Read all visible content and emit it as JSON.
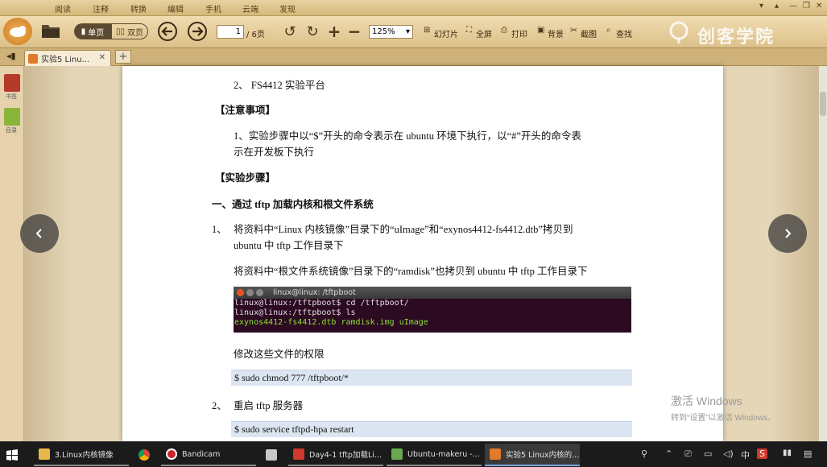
{
  "menubar": {
    "items": [
      "阅读",
      "注释",
      "转换",
      "编辑",
      "手机",
      "云端",
      "发现"
    ]
  },
  "toolbar": {
    "single_page": "单页",
    "double_page": "双页",
    "page_input": "1",
    "page_total": "/ 6页",
    "zoom": "125%",
    "slideshow": "幻灯片",
    "fullscreen": "全屏",
    "print": "打印",
    "background": "背景",
    "screenshot": "截图",
    "search": "查找",
    "brand": "创客学院"
  },
  "tabs": [
    {
      "label": "实验5 Linu..."
    }
  ],
  "sidebar": {
    "bookmark": "书签",
    "toc": "目录"
  },
  "document": {
    "l1": "2、 FS4412 实验平台",
    "l2": "【注意事项】",
    "l3": "1、实验步骤中以“$”开头的命令表示在 ubuntu 环境下执行，以“#”开头的命令表",
    "l4": "示在开发板下执行",
    "l5": "【实验步骤】",
    "l6": "一、通过 tftp 加载内核和根文件系统",
    "l7_num": "1、",
    "l7": "将资料中“Linux 内核镜像”目录下的“uImage”和“exynos4412-fs4412.dtb”拷贝到",
    "l8": "ubuntu 中 tftp 工作目录下",
    "l9": "将资料中“根文件系统镜像”目录下的“ramdisk”也拷贝到 ubuntu 中 tftp 工作目录下",
    "terminal": {
      "title": "linux@linux: /tftpboot",
      "line1": "linux@linux:/tftpboot$ cd /tftpboot/",
      "line2": "linux@linux:/tftpboot$ ls",
      "line3": "exynos4412-fs4412.dtb  ramdisk.img  uImage"
    },
    "l10": "修改这些文件的权限",
    "code1": "$ sudo    chmod    777    /tftpboot/*",
    "l11_num": "2、",
    "l11": "重启 tftp 服务器",
    "code2": "$ sudo    service    tftpd-hpa    restart"
  },
  "watermark": {
    "line1": "激活 Windows",
    "line2": "转到“设置”以激活 Windows。"
  },
  "taskbar": {
    "items": [
      {
        "label": "3.Linux内核镜像"
      },
      {
        "label": ""
      },
      {
        "label": "Bandicam"
      },
      {
        "label": ""
      },
      {
        "label": "Day4-1 tftp加载Li..."
      },
      {
        "label": "Ubuntu-makeru -..."
      },
      {
        "label": "实验5 Linux内核的..."
      }
    ],
    "ime": "中"
  },
  "colors": {
    "accent": "#7aa7e0",
    "terminal_bg": "#2c0a22",
    "terminal_green": "#8ae234",
    "code_bg": "#dce6f2"
  }
}
